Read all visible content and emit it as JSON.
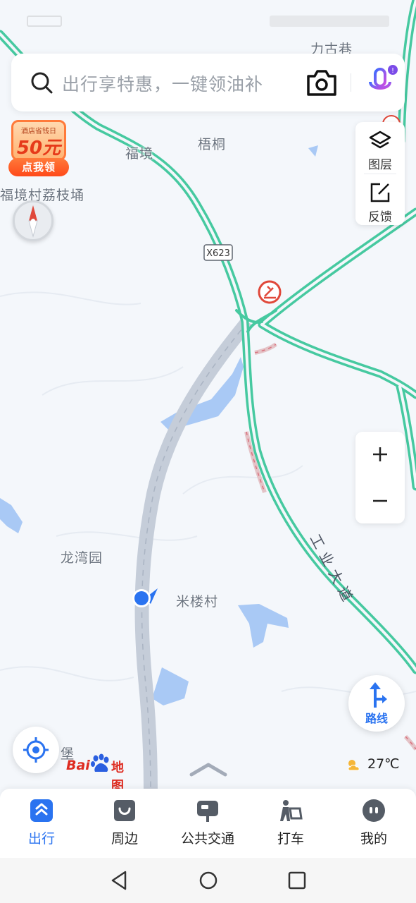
{
  "search": {
    "placeholder": "出行享特惠，一键领油补",
    "icons": [
      "search-icon",
      "camera-icon",
      "mic-icon"
    ]
  },
  "promo": {
    "subtitle": "酒店省钱日",
    "amount": "50元",
    "button": "点我领"
  },
  "map": {
    "labels": {
      "ligu_lane": "力古巷",
      "fujing": "福境",
      "wutong": "梧桐",
      "fujing_village": "福境村荔枝埇",
      "road_code": "X623",
      "longwan": "龙湾园",
      "milou": "米楼村",
      "industrial_avenue": "工业大道",
      "bao": "堡"
    }
  },
  "toolbar": {
    "layers_label": "图层",
    "feedback_label": "反馈"
  },
  "route": {
    "label": "路线"
  },
  "logo": {
    "bai": "Bai",
    "map_text": "地图"
  },
  "weather": {
    "temp": "27℃",
    "icon": "cloud-sun-icon"
  },
  "tabs": [
    {
      "label": "出行",
      "icon": "travel-icon",
      "active": true
    },
    {
      "label": "周边",
      "icon": "nearby-icon",
      "active": false
    },
    {
      "label": "公共交通",
      "icon": "bus-icon",
      "active": false
    },
    {
      "label": "打车",
      "icon": "taxi-icon",
      "active": false
    },
    {
      "label": "我的",
      "icon": "profile-icon",
      "active": false
    }
  ],
  "colors": {
    "accent": "#2a73f0",
    "road_green": "#46c9a0",
    "highway_gray": "#c5cdd9",
    "water": "#a9c9f5",
    "map_bg": "#f4f7fb"
  }
}
